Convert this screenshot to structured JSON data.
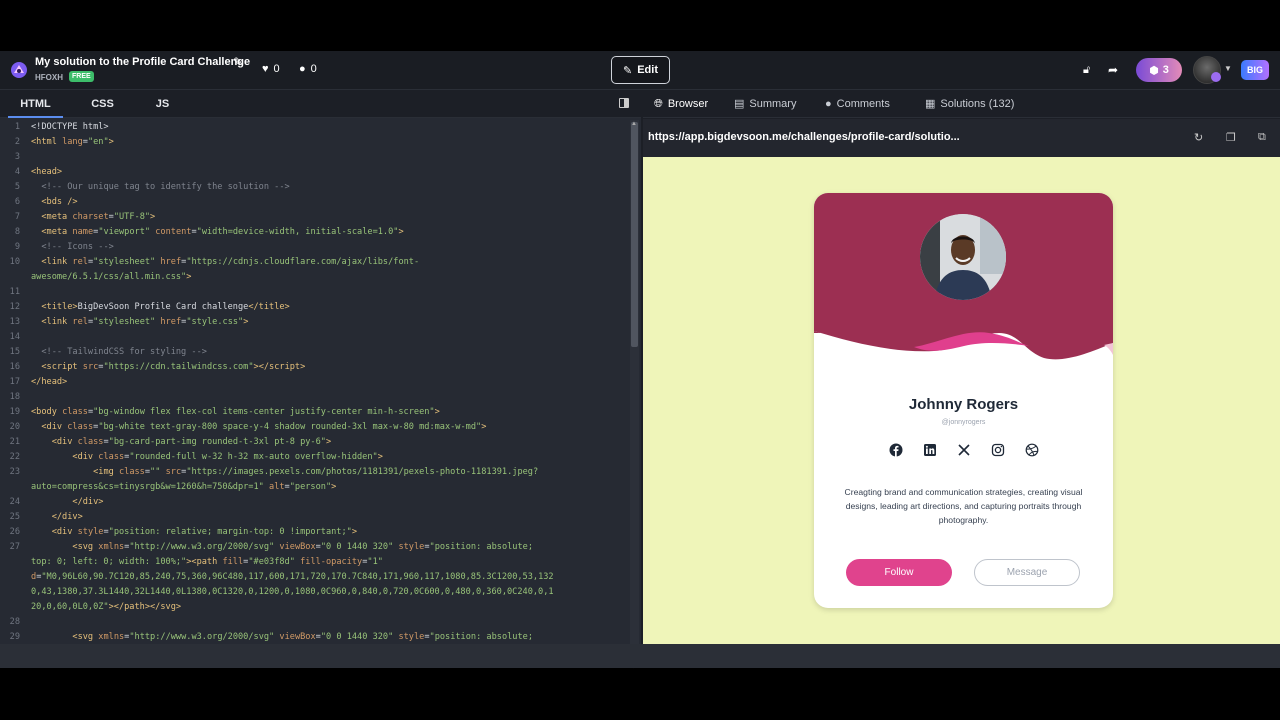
{
  "header": {
    "title": "My solution to the Profile Card Challenge",
    "user": "HFOXH",
    "badge": "FREE",
    "likes": "0",
    "comments": "0",
    "edit_label": "Edit",
    "coins": "3",
    "big_badge": "BIG"
  },
  "editor": {
    "tabs": [
      "HTML",
      "CSS",
      "JS"
    ],
    "active_tab": "HTML"
  },
  "browser": {
    "tabs": [
      "Browser",
      "Summary",
      "Comments",
      "Solutions (132)"
    ],
    "url": "https://app.bigdevsoon.me/challenges/profile-card/solutio..."
  },
  "card": {
    "name": "Johnny Rogers",
    "handle": "@jonnyrogers",
    "bio": "Creagting brand and communication strategies, creating visual designs, leading art directions, and capturing portraits through photography.",
    "follow_label": "Follow",
    "message_label": "Message",
    "header_color": "#9c2f52",
    "wave_color": "#e03f8d",
    "follow_color": "#e0438d"
  }
}
